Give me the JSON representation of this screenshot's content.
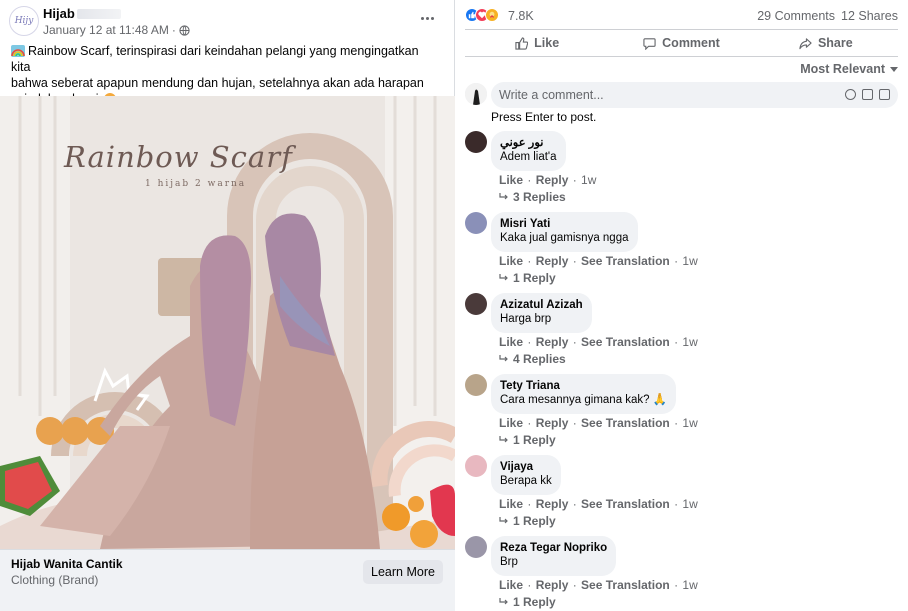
{
  "post": {
    "page_name": "Hijab",
    "date": "January 12 at 11:48 AM",
    "caption_line1": "Rainbow Scarf, terinspirasi dari keindahan pelangi yang mengingatkan kita",
    "caption_line2": "bahwa seberat apapun mendung dan hujan, setelahnya akan ada harapan",
    "caption_line3": "seindah pelangi",
    "image_title": "Rainbow Scarf",
    "image_subtitle": "1 hijab 2 warna",
    "cta_title": "Hijab Wanita Cantik",
    "cta_subtitle": "Clothing (Brand)",
    "cta_button": "Learn More"
  },
  "stats": {
    "reaction_count": "7.8K",
    "comments": "29 Comments",
    "shares": "12 Shares"
  },
  "actions": {
    "like": "Like",
    "comment": "Comment",
    "share": "Share"
  },
  "sort_label": "Most Relevant",
  "composer": {
    "placeholder": "Write a comment...",
    "hint": "Press Enter to post."
  },
  "comment_labels": {
    "like": "Like",
    "reply": "Reply",
    "see_translation": "See Translation"
  },
  "comments": [
    {
      "author": "نور عوني",
      "text": "Adem liat'a",
      "time": "1w",
      "replies": "3 Replies",
      "avatar_color": "#3a2a2a"
    },
    {
      "author": "Misri Yati",
      "text": "Kaka jual gamisnya ngga",
      "time": "1w",
      "replies": "1 Reply",
      "avatar_color": "#8a90b8"
    },
    {
      "author": "Azizatul Azizah",
      "text": "Harga brp",
      "time": "1w",
      "replies": "4 Replies",
      "avatar_color": "#4a3a3a"
    },
    {
      "author": "Tety Triana",
      "text": "Cara mesannya gimana kak? 🙏",
      "time": "1w",
      "replies": "1 Reply",
      "avatar_color": "#b8a48a"
    },
    {
      "author": "Vijaya",
      "text": "Berapa kk",
      "time": "1w",
      "replies": "1 Reply",
      "avatar_color": "#e8b8c0"
    },
    {
      "author": "Reza Tegar Nopriko",
      "text": "Brp",
      "time": "1w",
      "replies": "1 Reply",
      "avatar_color": "#9a96a8"
    }
  ]
}
